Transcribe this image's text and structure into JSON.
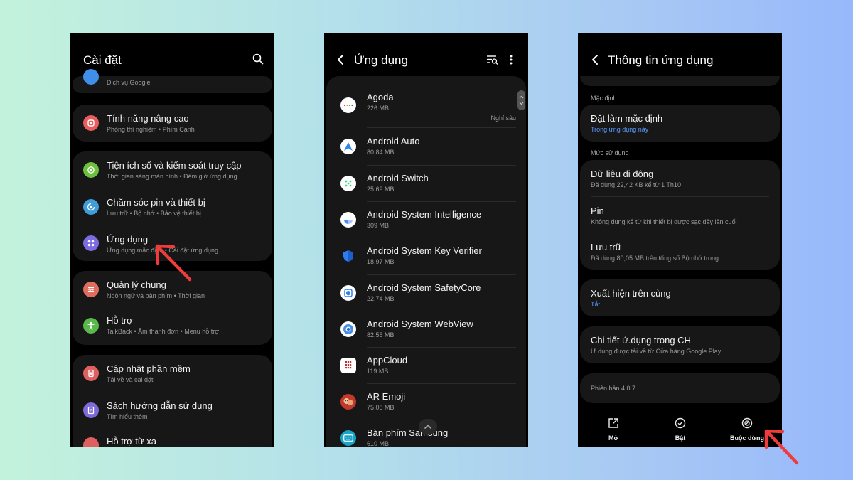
{
  "settings": {
    "title": "Cài đặt",
    "google_sub": "Dịch vụ Google",
    "items": [
      {
        "title": "Tính năng nâng cao",
        "sub": "Phòng thí nghiệm  •  Phím Cạnh",
        "color": "#e85d5d"
      },
      {
        "title": "Tiện ích số và kiểm soát truy cập",
        "sub": "Thời gian sáng màn hình  •  Đếm giờ ứng dụng",
        "color": "#6dbf3e"
      },
      {
        "title": "Chăm sóc pin và thiết bị",
        "sub": "Lưu trữ  •  Bộ nhớ  •  Bảo vệ thiết bị",
        "color": "#3f9dd8"
      },
      {
        "title": "Ứng dụng",
        "sub": "Ứng dụng mặc định  •  Cài đặt ứng dụng",
        "color": "#7b6ce0"
      },
      {
        "title": "Quản lý chung",
        "sub": "Ngôn ngữ và bàn phím  •  Thời gian",
        "color": "#e06d5d"
      },
      {
        "title": "Hỗ trợ",
        "sub": "TalkBack  •  Âm thanh đơn  •  Menu hỗ trợ",
        "color": "#59b84a"
      },
      {
        "title": "Cập nhật phần mềm",
        "sub": "Tải về và cài đặt",
        "color": "#e06060"
      },
      {
        "title": "Sách hướng dẫn sử dụng",
        "sub": "Tìm hiểu thêm",
        "color": "#7e6ad8"
      },
      {
        "title": "Hỗ trợ từ xa",
        "sub": "",
        "color": "#e06060"
      }
    ]
  },
  "apps": {
    "title": "Ứng dụng",
    "list": [
      {
        "name": "Agoda",
        "size": "226 MB",
        "status": "Nghỉ sâu"
      },
      {
        "name": "Android Auto",
        "size": "80,84 MB"
      },
      {
        "name": "Android Switch",
        "size": "25,69 MB"
      },
      {
        "name": "Android System Intelligence",
        "size": "309 MB"
      },
      {
        "name": "Android System Key Verifier",
        "size": "18,97 MB"
      },
      {
        "name": "Android System SafetyCore",
        "size": "22,74 MB"
      },
      {
        "name": "Android System WebView",
        "size": "82,55 MB"
      },
      {
        "name": "AppCloud",
        "size": "119 MB"
      },
      {
        "name": "AR Emoji",
        "size": "75,08 MB"
      },
      {
        "name": "Bàn phím Samsung",
        "size": "610 MB"
      }
    ]
  },
  "appinfo": {
    "title": "Thông tin ứng dụng",
    "section_default": "Mặc định",
    "set_default_title": "Đặt làm mặc định",
    "set_default_sub": "Trong ứng dụng này",
    "section_usage": "Mức sử dụng",
    "mobile_data_title": "Dữ liệu di động",
    "mobile_data_sub": "Đã dùng 22,42 KB kể từ 1 Th10",
    "battery_title": "Pin",
    "battery_sub": "Không dùng kể từ khi thiết bị được sạc đầy lần cuối",
    "storage_title": "Lưu trữ",
    "storage_sub": "Đã dùng 80,05 MB trên tổng số Bộ nhớ trong",
    "overlay_title": "Xuất hiện trên cùng",
    "overlay_sub": "Tắt",
    "store_title": "Chi tiết ứ.dụng trong CH",
    "store_sub": "Ư.dụng được tải về từ Cửa hàng Google Play",
    "version": "Phiên bản 4.0.7",
    "btn_open": "Mở",
    "btn_enable": "Bật",
    "btn_force_stop": "Buộc dừng"
  },
  "colors": {
    "arrow": "#ee3b3b",
    "link_blue": "#5a9bff"
  }
}
